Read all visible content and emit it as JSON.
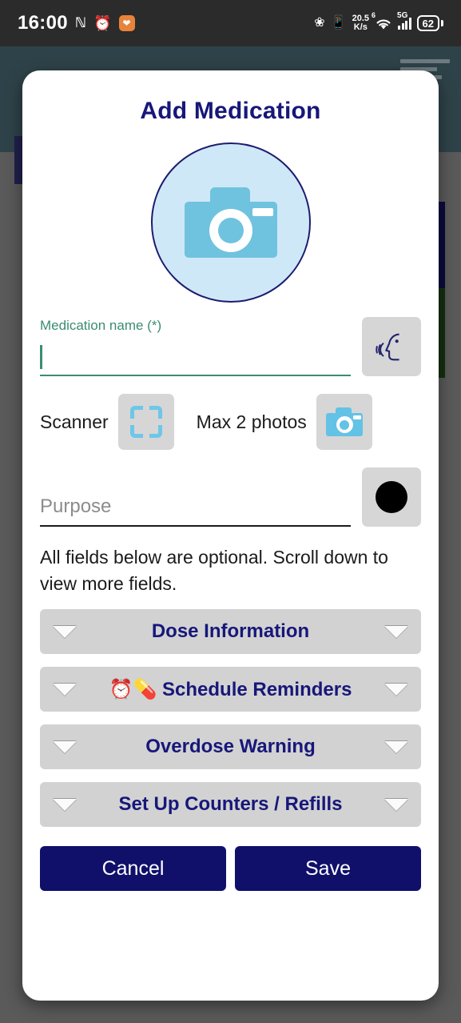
{
  "status_bar": {
    "time": "16:00",
    "nfc_icon": "nfc-icon",
    "alarm_icon": "alarm-icon",
    "app_badge_icon": "shield-badge-icon",
    "bluetooth_icon": "bluetooth-icon",
    "vibrate_icon": "vibrate-icon",
    "net_speed_value": "20.5",
    "net_speed_unit": "K/s",
    "wifi_label": "6",
    "wifi_icon": "wifi-icon",
    "network_label": "5G",
    "signal_icon": "signal-bars-icon",
    "battery_level": "62"
  },
  "background": {
    "menu_icon": "hamburger-menu-icon",
    "header_color": "#2e4349",
    "scrim_color": "#5a5a5a"
  },
  "modal": {
    "title": "Add Medication",
    "photo_picker": {
      "icon": "camera-icon",
      "circle_fill": "#cfe8f8",
      "circle_border": "#1c1c6e",
      "glyph_color": "#6fc3de"
    },
    "medication_name": {
      "label": "Medication name (*)",
      "value": "",
      "placeholder": "",
      "accent_color": "#3b8c72",
      "voice_icon": "speaking-head-icon"
    },
    "scanner_row": {
      "scanner_label": "Scanner",
      "scanner_icon": "barcode-scan-frame-icon",
      "photos_label": "Max 2 photos",
      "photos_icon": "camera-icon"
    },
    "purpose": {
      "placeholder": "Purpose",
      "value": "",
      "action_icon": "record-dot-icon"
    },
    "note": "All fields below are optional. Scroll down to view more fields.",
    "sections": [
      {
        "title": "Dose Information",
        "left_icon": "chevron-down-icon",
        "right_icon": "chevron-down-icon",
        "expanded": false
      },
      {
        "title": "⏰💊 Schedule Reminders",
        "left_icon": "chevron-down-icon",
        "right_icon": "chevron-down-icon",
        "expanded": false
      },
      {
        "title": "Overdose Warning",
        "left_icon": "chevron-down-icon",
        "right_icon": "chevron-down-icon",
        "expanded": false
      },
      {
        "title": "Set Up Counters / Refills",
        "left_icon": "chevron-down-icon",
        "right_icon": "chevron-down-icon",
        "expanded": false
      }
    ],
    "footer": {
      "cancel_label": "Cancel",
      "save_label": "Save",
      "button_color": "#10106b"
    },
    "accent_navy": "#17177a"
  }
}
